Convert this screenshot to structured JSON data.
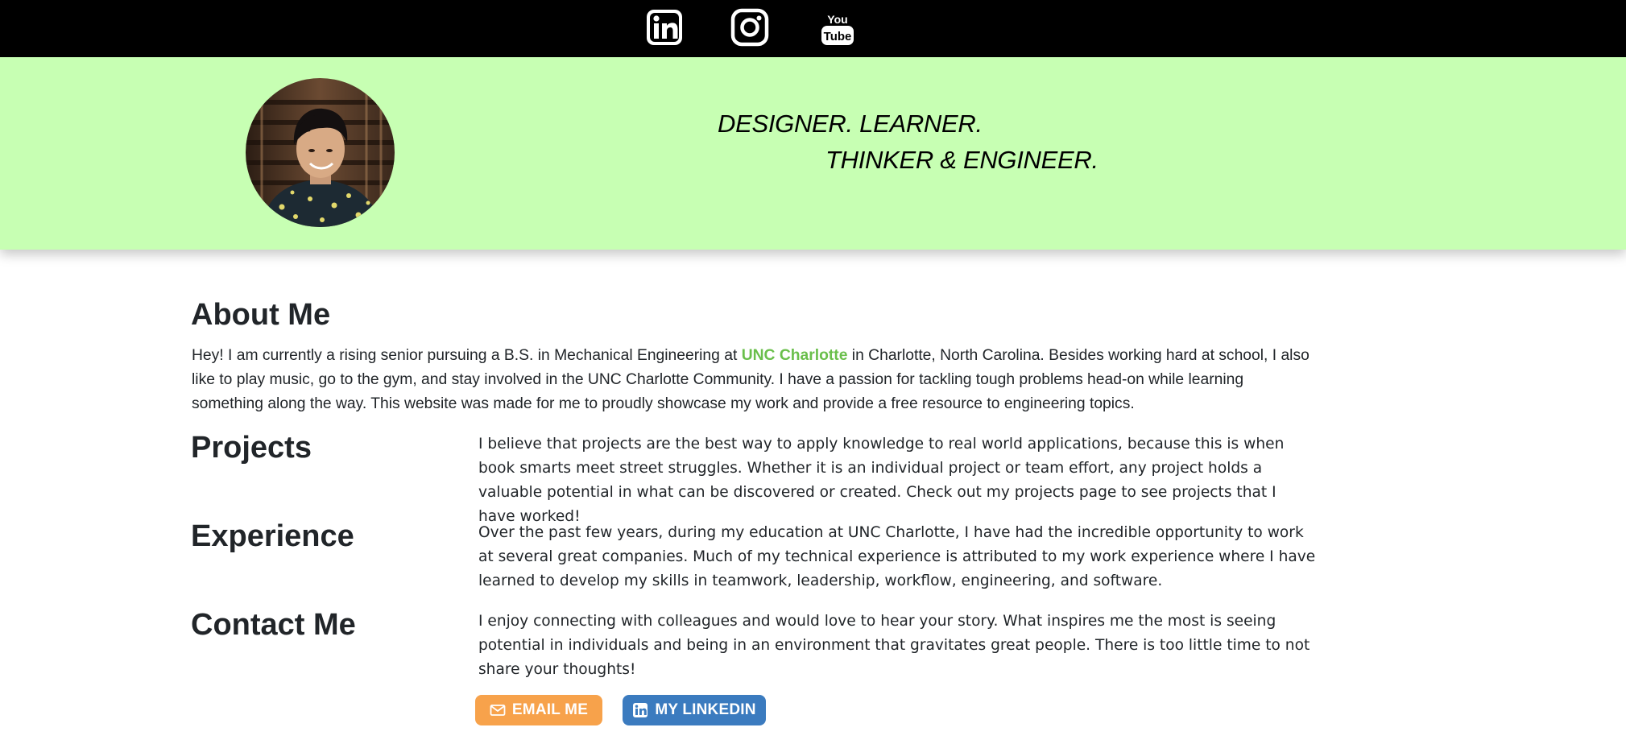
{
  "social": {
    "items": [
      {
        "name": "linkedin",
        "icon": "linkedin-icon"
      },
      {
        "name": "instagram",
        "icon": "instagram-icon"
      },
      {
        "name": "youtube",
        "icon": "youtube-icon",
        "text_top": "You",
        "text_bottom": "Tube"
      }
    ]
  },
  "hero": {
    "tagline_line1": "DESIGNER. LEARNER.",
    "tagline_line2": "THINKER & ENGINEER.",
    "background_color": "#c7ffb3",
    "avatar_icon": "profile-photo"
  },
  "about": {
    "heading": "About Me",
    "text_before": "Hey! I am currently a rising senior pursuing a B.S. in Mechanical Engineering at ",
    "link_text": "UNC Charlotte",
    "text_after": " in Charlotte, North Carolina. Besides working hard at school, I also like to play music, go to the gym, and stay involved in the UNC Charlotte Community. I have a passion for tackling tough problems head-on while learning something along the way. This website was made for me to proudly showcase my work and provide a free resource to engineering topics."
  },
  "sections": [
    {
      "heading": "Projects",
      "text": "I believe that projects are the best way to apply knowledge to real world applications, because this is when book smarts meet street struggles. Whether it is an individual project or team effort, any project holds a valuable potential in what can be discovered or created. Check out my projects page to see projects that I have worked!"
    },
    {
      "heading": "Experience",
      "text": "Over the past few years, during my education at UNC Charlotte, I have had the incredible opportunity to work at several great companies. Much of my technical experience is attributed to my work experience where I have learned to develop my skills in teamwork, leadership, workflow, engineering, and software."
    },
    {
      "heading": "Contact Me",
      "text": "I enjoy connecting with colleagues and would love to hear your story. What inspires me the most is seeing potential in individuals and being in an environment that gravitates great people. There is too little time to not share your thoughts!"
    }
  ],
  "buttons": {
    "email_label": "EMAIL ME",
    "email_icon": "envelope-icon",
    "linkedin_label": "MY LINKEDIN",
    "linkedin_icon": "linkedin-icon"
  },
  "colors": {
    "accent_link": "#6abf4b",
    "email_button": "#f7a24b",
    "linkedin_button": "#3b7bbf"
  }
}
